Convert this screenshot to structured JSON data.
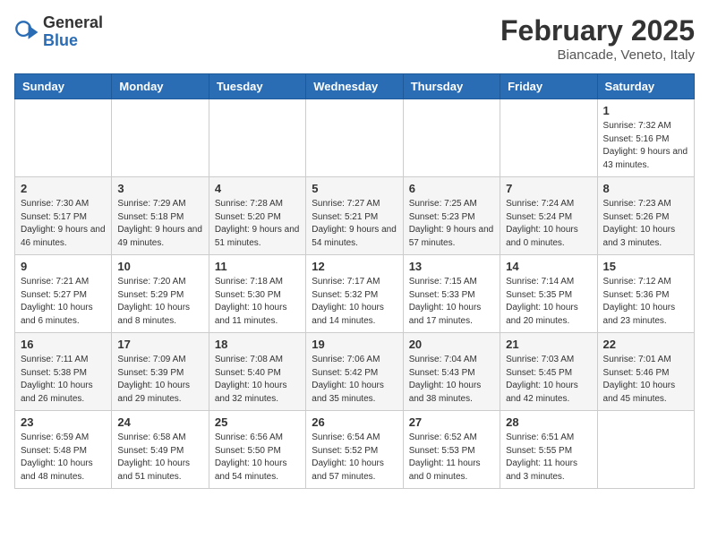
{
  "header": {
    "logo": {
      "general": "General",
      "blue": "Blue"
    },
    "title": "February 2025",
    "subtitle": "Biancade, Veneto, Italy"
  },
  "weekdays": [
    "Sunday",
    "Monday",
    "Tuesday",
    "Wednesday",
    "Thursday",
    "Friday",
    "Saturday"
  ],
  "weeks": [
    [
      {
        "day": "",
        "info": ""
      },
      {
        "day": "",
        "info": ""
      },
      {
        "day": "",
        "info": ""
      },
      {
        "day": "",
        "info": ""
      },
      {
        "day": "",
        "info": ""
      },
      {
        "day": "",
        "info": ""
      },
      {
        "day": "1",
        "info": "Sunrise: 7:32 AM\nSunset: 5:16 PM\nDaylight: 9 hours and 43 minutes."
      }
    ],
    [
      {
        "day": "2",
        "info": "Sunrise: 7:30 AM\nSunset: 5:17 PM\nDaylight: 9 hours and 46 minutes."
      },
      {
        "day": "3",
        "info": "Sunrise: 7:29 AM\nSunset: 5:18 PM\nDaylight: 9 hours and 49 minutes."
      },
      {
        "day": "4",
        "info": "Sunrise: 7:28 AM\nSunset: 5:20 PM\nDaylight: 9 hours and 51 minutes."
      },
      {
        "day": "5",
        "info": "Sunrise: 7:27 AM\nSunset: 5:21 PM\nDaylight: 9 hours and 54 minutes."
      },
      {
        "day": "6",
        "info": "Sunrise: 7:25 AM\nSunset: 5:23 PM\nDaylight: 9 hours and 57 minutes."
      },
      {
        "day": "7",
        "info": "Sunrise: 7:24 AM\nSunset: 5:24 PM\nDaylight: 10 hours and 0 minutes."
      },
      {
        "day": "8",
        "info": "Sunrise: 7:23 AM\nSunset: 5:26 PM\nDaylight: 10 hours and 3 minutes."
      }
    ],
    [
      {
        "day": "9",
        "info": "Sunrise: 7:21 AM\nSunset: 5:27 PM\nDaylight: 10 hours and 6 minutes."
      },
      {
        "day": "10",
        "info": "Sunrise: 7:20 AM\nSunset: 5:29 PM\nDaylight: 10 hours and 8 minutes."
      },
      {
        "day": "11",
        "info": "Sunrise: 7:18 AM\nSunset: 5:30 PM\nDaylight: 10 hours and 11 minutes."
      },
      {
        "day": "12",
        "info": "Sunrise: 7:17 AM\nSunset: 5:32 PM\nDaylight: 10 hours and 14 minutes."
      },
      {
        "day": "13",
        "info": "Sunrise: 7:15 AM\nSunset: 5:33 PM\nDaylight: 10 hours and 17 minutes."
      },
      {
        "day": "14",
        "info": "Sunrise: 7:14 AM\nSunset: 5:35 PM\nDaylight: 10 hours and 20 minutes."
      },
      {
        "day": "15",
        "info": "Sunrise: 7:12 AM\nSunset: 5:36 PM\nDaylight: 10 hours and 23 minutes."
      }
    ],
    [
      {
        "day": "16",
        "info": "Sunrise: 7:11 AM\nSunset: 5:38 PM\nDaylight: 10 hours and 26 minutes."
      },
      {
        "day": "17",
        "info": "Sunrise: 7:09 AM\nSunset: 5:39 PM\nDaylight: 10 hours and 29 minutes."
      },
      {
        "day": "18",
        "info": "Sunrise: 7:08 AM\nSunset: 5:40 PM\nDaylight: 10 hours and 32 minutes."
      },
      {
        "day": "19",
        "info": "Sunrise: 7:06 AM\nSunset: 5:42 PM\nDaylight: 10 hours and 35 minutes."
      },
      {
        "day": "20",
        "info": "Sunrise: 7:04 AM\nSunset: 5:43 PM\nDaylight: 10 hours and 38 minutes."
      },
      {
        "day": "21",
        "info": "Sunrise: 7:03 AM\nSunset: 5:45 PM\nDaylight: 10 hours and 42 minutes."
      },
      {
        "day": "22",
        "info": "Sunrise: 7:01 AM\nSunset: 5:46 PM\nDaylight: 10 hours and 45 minutes."
      }
    ],
    [
      {
        "day": "23",
        "info": "Sunrise: 6:59 AM\nSunset: 5:48 PM\nDaylight: 10 hours and 48 minutes."
      },
      {
        "day": "24",
        "info": "Sunrise: 6:58 AM\nSunset: 5:49 PM\nDaylight: 10 hours and 51 minutes."
      },
      {
        "day": "25",
        "info": "Sunrise: 6:56 AM\nSunset: 5:50 PM\nDaylight: 10 hours and 54 minutes."
      },
      {
        "day": "26",
        "info": "Sunrise: 6:54 AM\nSunset: 5:52 PM\nDaylight: 10 hours and 57 minutes."
      },
      {
        "day": "27",
        "info": "Sunrise: 6:52 AM\nSunset: 5:53 PM\nDaylight: 11 hours and 0 minutes."
      },
      {
        "day": "28",
        "info": "Sunrise: 6:51 AM\nSunset: 5:55 PM\nDaylight: 11 hours and 3 minutes."
      },
      {
        "day": "",
        "info": ""
      }
    ]
  ]
}
